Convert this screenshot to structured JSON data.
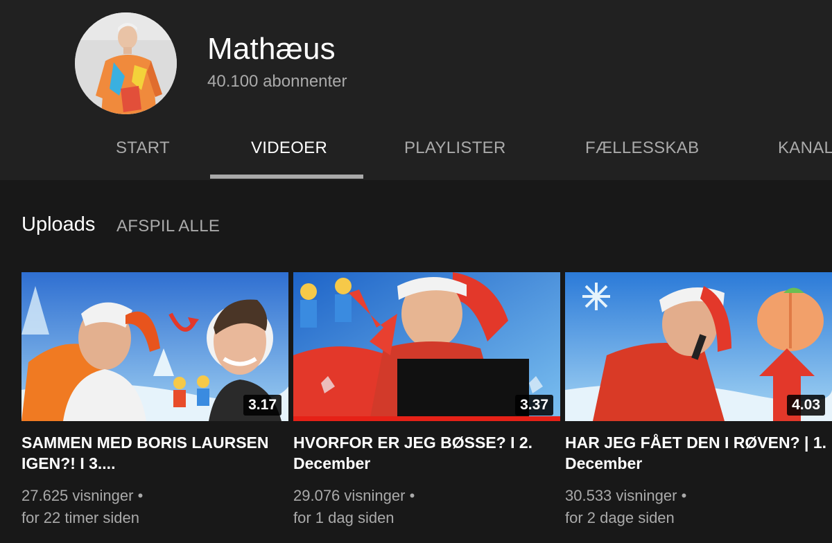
{
  "channel": {
    "name": "Mathæus",
    "subscribers": "40.100 abonnenter"
  },
  "tabs": [
    {
      "label": "START",
      "active": false
    },
    {
      "label": "VIDEOER",
      "active": true
    },
    {
      "label": "PLAYLISTER",
      "active": false
    },
    {
      "label": "FÆLLESSKAB",
      "active": false
    },
    {
      "label": "KANALER",
      "active": false
    }
  ],
  "section": {
    "title": "Uploads",
    "play_all": "AFSPIL ALLE"
  },
  "videos": [
    {
      "title": "SAMMEN MED BORIS LAURSEN IGEN?! I 3....",
      "duration": "3.17",
      "views": "27.625 visninger",
      "age": "for 22 timer siden",
      "watched_fraction": 0
    },
    {
      "title": "HVORFOR ER JEG BØSSE? I 2. December",
      "duration": "3.37",
      "views": "29.076 visninger",
      "age": "for 1 dag siden",
      "watched_fraction": 1
    },
    {
      "title": "HAR JEG FÅET DEN I RØVEN? | 1. December",
      "duration": "4.03",
      "views": "30.533 visninger",
      "age": "for 2 dage siden",
      "watched_fraction": 0
    }
  ],
  "colors": {
    "background": "#181818",
    "header": "#212121",
    "secondary_text": "#aaaaaa",
    "progress": "#e62117"
  }
}
